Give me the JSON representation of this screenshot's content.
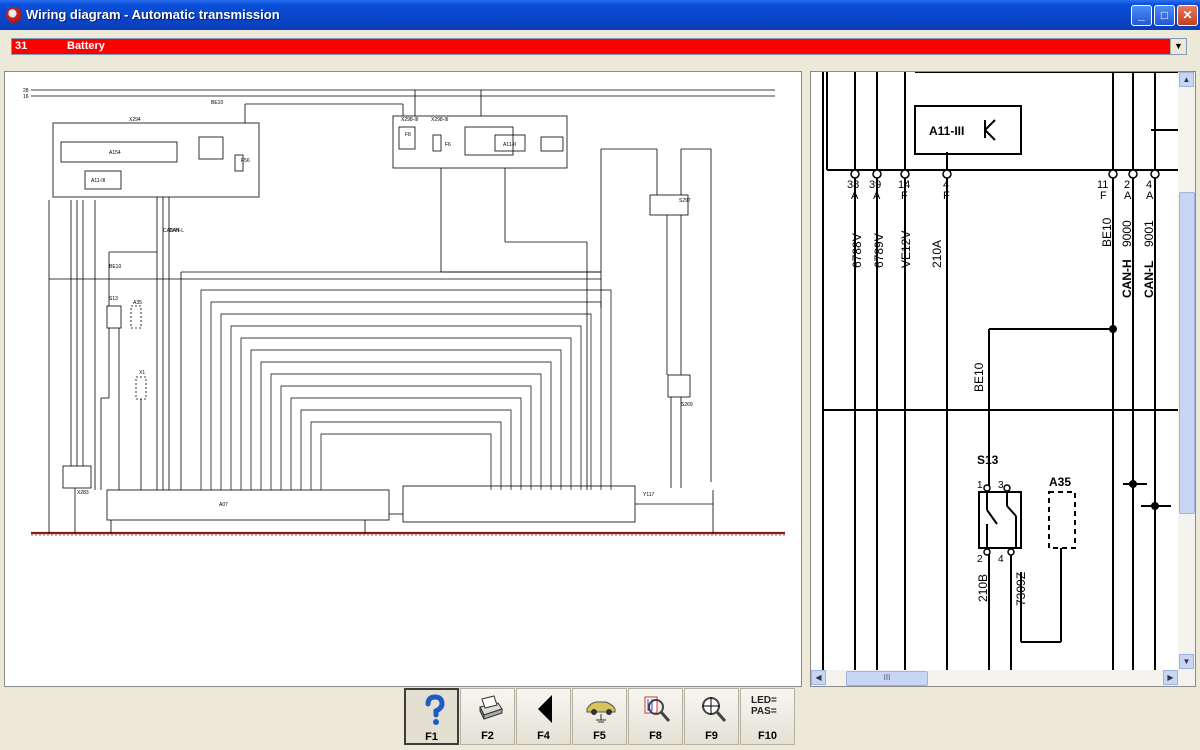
{
  "window": {
    "title": "Wiring diagram - Automatic transmission"
  },
  "selector": {
    "number": "31",
    "label": "Battery"
  },
  "left_diagram": {
    "labels": [
      "28",
      "16",
      "X294",
      "A154",
      "A11-III",
      "F56",
      "X298-III",
      "X298-III",
      "F8",
      "F6",
      "A11-II",
      "S13",
      "A35",
      "X1",
      "S297",
      "S269",
      "X283",
      "A07",
      "Y117",
      "BE10",
      "CAN-H",
      "CAN-L",
      "BE10"
    ]
  },
  "right_diagram": {
    "component_a11": "A11-III",
    "pins_left": [
      {
        "num": "38",
        "letter": "A",
        "wire": "6788V"
      },
      {
        "num": "39",
        "letter": "A",
        "wire": "6789V"
      },
      {
        "num": "14",
        "letter": "F",
        "wire": "VE12V"
      },
      {
        "num": "4",
        "letter": "F",
        "wire": "210A"
      }
    ],
    "pins_right": [
      {
        "num": "11",
        "letter": "F",
        "wire": "BE10",
        "bus": ""
      },
      {
        "num": "2",
        "letter": "A",
        "wire": "9000",
        "bus": "CAN-H"
      },
      {
        "num": "4",
        "letter": "A",
        "wire": "9001",
        "bus": "CAN-L"
      }
    ],
    "be10_lower": "BE10",
    "s13": {
      "name": "S13",
      "pin1": "1",
      "pin3": "3",
      "pin2": "2",
      "pin4": "4",
      "wire_a": "210B",
      "wire_b": "7309Z"
    },
    "a35": {
      "name": "A35"
    }
  },
  "scrollbar": {
    "thumb_glyph": "III"
  },
  "toolbar": {
    "buttons": [
      {
        "label": "F1",
        "icon": "help-icon"
      },
      {
        "label": "F2",
        "icon": "printer-icon"
      },
      {
        "label": "F4",
        "icon": "back-arrow-icon"
      },
      {
        "label": "F5",
        "icon": "car-ground-icon"
      },
      {
        "label": "F8",
        "icon": "component-zoom-icon"
      },
      {
        "label": "F9",
        "icon": "connector-zoom-icon"
      },
      {
        "label": "F10",
        "icon": "led-pas-icon"
      }
    ],
    "led_text_1": "LED=",
    "led_text_2": "PAS="
  },
  "colors": {
    "selector_bg": "#ff0000",
    "ground_line": "#8b1a1a",
    "wire": "#000000"
  }
}
